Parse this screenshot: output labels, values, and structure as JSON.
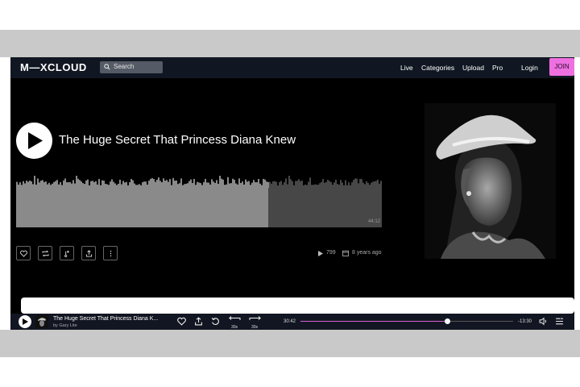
{
  "nav": {
    "logo": "M—XCLOUD",
    "search_placeholder": "Search",
    "links": [
      "Live",
      "Categories",
      "Upload",
      "Pro"
    ],
    "login": "Login",
    "join": "JOIN",
    "join_color": "#ee6fe0"
  },
  "show": {
    "title": "The Huge Secret That Princess Diana Knew",
    "duration": "44:12",
    "plays": "799",
    "posted": "8 years ago",
    "progress_fraction": 0.69,
    "actions": [
      "heart-icon",
      "repost-icon",
      "add-to-playlist-icon",
      "share-icon",
      "more-icon"
    ]
  },
  "player": {
    "title": "The Huge Secret That Princess Diana K...",
    "artist": "by Gary Lite",
    "skip_back": "30s",
    "skip_forward": "30s",
    "elapsed": "30:42",
    "remaining": "-13:30",
    "progress_fraction": 0.69,
    "accent_color": "#d760d8"
  }
}
